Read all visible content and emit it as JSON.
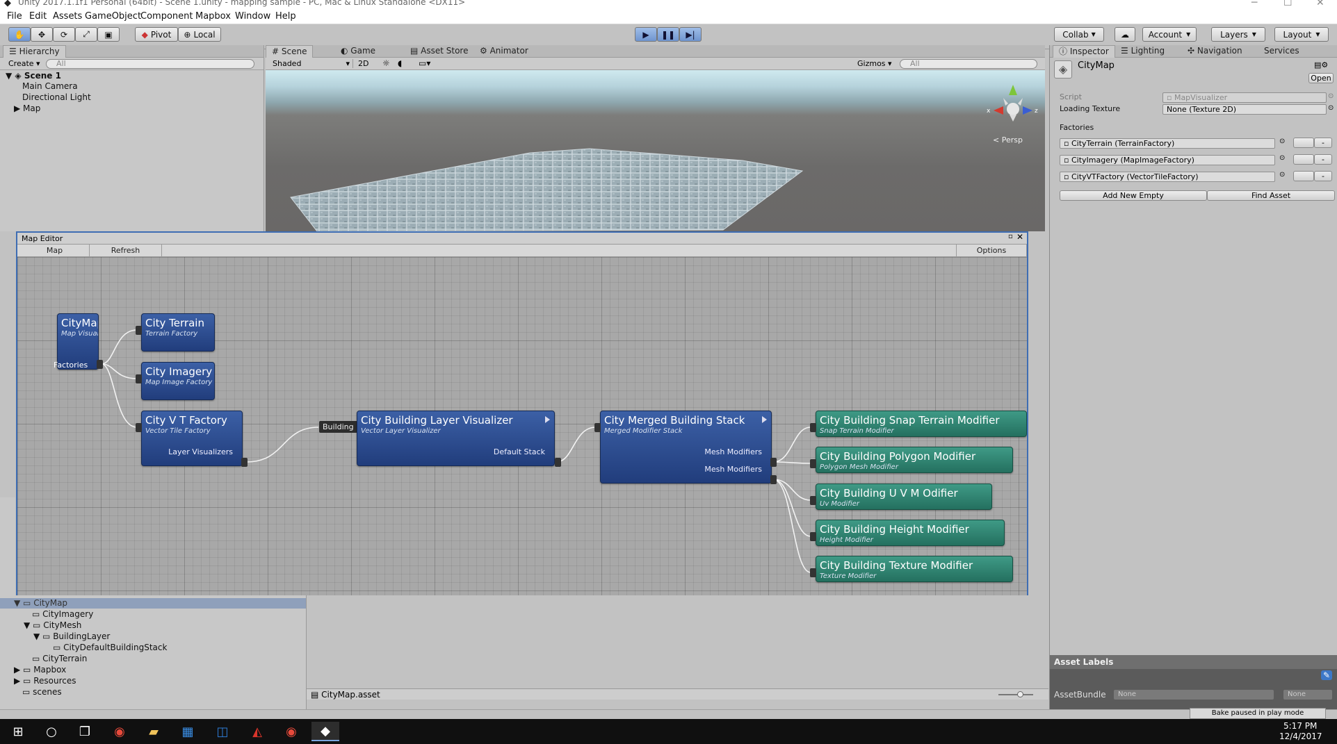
{
  "window": {
    "title": "Unity 2017.1.1f1 Personal (64bit) - Scene 1.unity - mapping sample - PC, Mac & Linux Standalone <DX11>"
  },
  "menu": [
    "File",
    "Edit",
    "Assets",
    "GameObject",
    "Component",
    "Mapbox",
    "Window",
    "Help"
  ],
  "toolbar": {
    "pivot": "Pivot",
    "local": "Local",
    "collab": "Collab",
    "account": "Account",
    "layers": "Layers",
    "layout": "Layout"
  },
  "hierarchy": {
    "tab": "Hierarchy",
    "create": "Create",
    "search_placeholder": "All",
    "scene": "Scene 1",
    "items": [
      "Main Camera",
      "Directional Light",
      "Map"
    ]
  },
  "scene_view": {
    "tabs": [
      "Scene",
      "Game",
      "Asset Store",
      "Animator"
    ],
    "shading": "Shaded",
    "mode2d": "2D",
    "gizmos": "Gizmos",
    "search_placeholder": "All",
    "persp": "Persp",
    "axis_x": "x",
    "axis_z": "z"
  },
  "map_editor": {
    "title": "Map Editor",
    "dropdown": "Map Visualizers",
    "refresh": "Refresh",
    "options": "Options",
    "nodes": {
      "citymap": {
        "title": "CityMap",
        "subtitle": "Map Visual",
        "port": "Factories"
      },
      "terrain": {
        "title": "City Terrain",
        "subtitle": "Terrain Factory"
      },
      "imagery": {
        "title": "City Imagery",
        "subtitle": "Map Image Factory"
      },
      "vtfactory": {
        "title": "City V T Factory",
        "subtitle": "Vector Tile Factory",
        "port": "Layer Visualizers"
      },
      "building_label": "Building",
      "layervis": {
        "title": "City Building Layer Visualizer",
        "subtitle": "Vector Layer Visualizer",
        "port": "Default Stack"
      },
      "merged": {
        "title": "City Merged Building Stack",
        "subtitle": "Merged Modifier Stack",
        "port1": "Mesh Modifiers",
        "port2": "Mesh Modifiers"
      },
      "snap": {
        "title": "City Building Snap Terrain Modifier",
        "subtitle": "Snap Terrain Modifier"
      },
      "polygon": {
        "title": "City Building Polygon Modifier",
        "subtitle": "Polygon Mesh Modifier"
      },
      "uvm": {
        "title": "City Building U V M Odifier",
        "subtitle": "Uv Modifier"
      },
      "height": {
        "title": "City Building Height Modifier",
        "subtitle": "Height Modifier"
      },
      "texture": {
        "title": "City Building Texture Modifier",
        "subtitle": "Texture Modifier"
      }
    }
  },
  "project": {
    "tree": [
      {
        "label": "CityMap"
      },
      {
        "label": "CityImagery"
      },
      {
        "label": "CityMesh"
      },
      {
        "label": "BuildingLayer"
      },
      {
        "label": "CityDefaultBuildingStack"
      },
      {
        "label": "CityTerrain"
      },
      {
        "label": "Mapbox"
      },
      {
        "label": "Resources"
      },
      {
        "label": "scenes"
      }
    ],
    "selected_asset": "CityMap.asset"
  },
  "inspector": {
    "tabs": [
      "Inspector",
      "Lighting",
      "Navigation",
      "Services"
    ],
    "object_name": "CityMap",
    "open": "Open",
    "script_label": "Script",
    "script_value": "MapVisualizer",
    "loading_label": "Loading Texture",
    "loading_value": "None (Texture 2D)",
    "factories_label": "Factories",
    "factories": [
      "CityTerrain (TerrainFactory)",
      "CityImagery (MapImageFactory)",
      "CityVTFactory (VectorTileFactory)"
    ],
    "minus": "-",
    "add_new_empty": "Add New Empty",
    "find_asset": "Find Asset",
    "asset_labels": "Asset Labels",
    "assetbundle_label": "AssetBundle",
    "assetbundle_value": "None",
    "assetbundle_variant": "None"
  },
  "status": {
    "bake": "Bake paused in play mode"
  },
  "taskbar": {
    "time": "5:17 PM",
    "date": "12/4/2017"
  },
  "colors": {
    "node_blue": "#2b4a8e",
    "node_green": "#2f8573",
    "selection": "#3e6db3"
  }
}
